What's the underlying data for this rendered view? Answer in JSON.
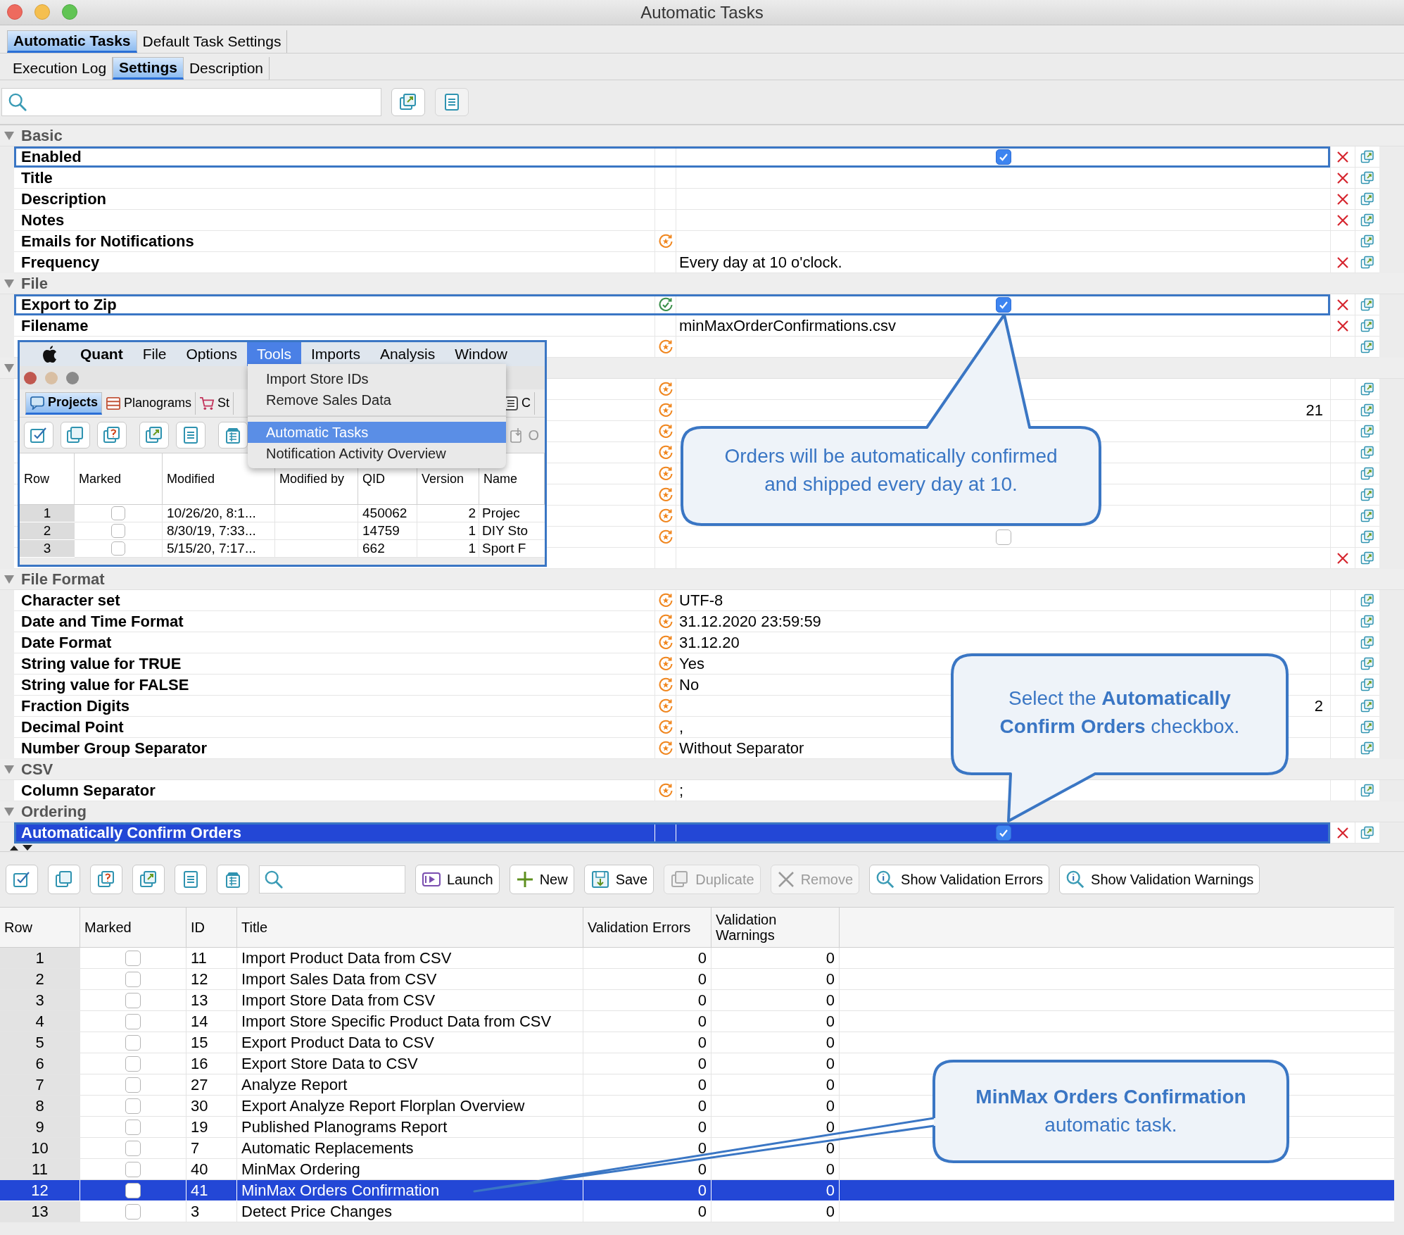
{
  "window": {
    "title": "Automatic Tasks"
  },
  "tabs": [
    {
      "label": "Automatic Tasks",
      "selected": true
    },
    {
      "label": "Default Task Settings",
      "selected": false
    }
  ],
  "subtabs": [
    {
      "label": "Execution Log",
      "selected": false
    },
    {
      "label": "Settings",
      "selected": true
    },
    {
      "label": "Description",
      "selected": false
    }
  ],
  "properties": [
    {
      "kind": "group",
      "label": "Basic",
      "expanded": true
    },
    {
      "kind": "checkbox",
      "label": "Enabled",
      "checked": true,
      "inherited": false,
      "linked": false,
      "reset": true,
      "highlighted": true,
      "selected": false
    },
    {
      "kind": "empty",
      "label": "Title",
      "inherited": false,
      "linked": false,
      "reset": true,
      "highlighted": false,
      "selected": false
    },
    {
      "kind": "empty",
      "label": "Description",
      "inherited": false,
      "linked": false,
      "reset": true,
      "highlighted": false,
      "selected": false
    },
    {
      "kind": "empty",
      "label": "Notes",
      "inherited": false,
      "linked": false,
      "reset": true,
      "highlighted": false,
      "selected": false
    },
    {
      "kind": "empty",
      "label": "Emails for Notifications",
      "inherited": true,
      "linked": false,
      "reset": false,
      "highlighted": false,
      "selected": false
    },
    {
      "kind": "text",
      "label": "Frequency",
      "value": "Every day at 10 o'clock.",
      "inherited": false,
      "linked": false,
      "reset": true,
      "highlighted": false,
      "selected": false
    },
    {
      "kind": "group",
      "label": "File",
      "expanded": true
    },
    {
      "kind": "checkbox",
      "label": "Export to Zip",
      "checked": true,
      "inherited": false,
      "linked": true,
      "reset": true,
      "highlighted": true,
      "selected": false
    },
    {
      "kind": "text",
      "label": "Filename",
      "value": "minMaxOrderConfirmations.csv",
      "inherited": false,
      "linked": false,
      "reset": true,
      "highlighted": false,
      "selected": false
    },
    {
      "kind": "empty",
      "inherited": true,
      "linked": false,
      "reset": false,
      "highlighted": false,
      "selected": false
    },
    {
      "kind": "group",
      "expanded": true
    },
    {
      "kind": "empty",
      "inherited": true,
      "linked": false,
      "reset": false,
      "highlighted": false,
      "selected": false
    },
    {
      "kind": "number",
      "value": "21",
      "inherited": true,
      "linked": false,
      "reset": false,
      "highlighted": false,
      "selected": false
    },
    {
      "kind": "empty",
      "inherited": true,
      "linked": false,
      "reset": false,
      "highlighted": false,
      "selected": false
    },
    {
      "kind": "empty",
      "inherited": true,
      "linked": false,
      "reset": false,
      "highlighted": false,
      "selected": false
    },
    {
      "kind": "empty",
      "inherited": true,
      "linked": false,
      "reset": false,
      "highlighted": false,
      "selected": false
    },
    {
      "kind": "empty",
      "inherited": true,
      "linked": false,
      "reset": false,
      "highlighted": false,
      "selected": false
    },
    {
      "kind": "empty",
      "inherited": true,
      "linked": false,
      "reset": false,
      "highlighted": false,
      "selected": false
    },
    {
      "kind": "checkbox",
      "checked": false,
      "inherited": true,
      "linked": false,
      "reset": false,
      "highlighted": false,
      "selected": false
    },
    {
      "kind": "empty",
      "inherited": false,
      "linked": false,
      "reset": true,
      "highlighted": false,
      "selected": false
    },
    {
      "kind": "group",
      "label": "File Format",
      "expanded": true
    },
    {
      "kind": "text",
      "label": "Character set",
      "value": "UTF-8",
      "inherited": true,
      "linked": false,
      "reset": false,
      "highlighted": false,
      "selected": false
    },
    {
      "kind": "text",
      "label": "Date and Time Format",
      "value": "31.12.2020 23:59:59",
      "inherited": true,
      "linked": false,
      "reset": false,
      "highlighted": false,
      "selected": false
    },
    {
      "kind": "text",
      "label": "Date Format",
      "value": "31.12.20",
      "inherited": true,
      "linked": false,
      "reset": false,
      "highlighted": false,
      "selected": false
    },
    {
      "kind": "text",
      "label": "String value for TRUE",
      "value": "Yes",
      "inherited": true,
      "linked": false,
      "reset": false,
      "highlighted": false,
      "selected": false
    },
    {
      "kind": "text",
      "label": "String value for FALSE",
      "value": "No",
      "inherited": true,
      "linked": false,
      "reset": false,
      "highlighted": false,
      "selected": false
    },
    {
      "kind": "number",
      "label": "Fraction Digits",
      "value": "2",
      "inherited": true,
      "linked": false,
      "reset": false,
      "highlighted": false,
      "selected": false
    },
    {
      "kind": "text",
      "label": "Decimal Point",
      "value": ",",
      "inherited": true,
      "linked": false,
      "reset": false,
      "highlighted": false,
      "selected": false
    },
    {
      "kind": "text",
      "label": "Number Group Separator",
      "value": "Without Separator",
      "inherited": true,
      "linked": false,
      "reset": false,
      "highlighted": false,
      "selected": false
    },
    {
      "kind": "group",
      "label": "CSV",
      "expanded": true
    },
    {
      "kind": "text",
      "label": "Column Separator",
      "value": ";",
      "inherited": true,
      "linked": false,
      "reset": false,
      "highlighted": false,
      "selected": false
    },
    {
      "kind": "group",
      "label": "Ordering",
      "expanded": true
    },
    {
      "kind": "checkbox",
      "label": "Automatically Confirm Orders",
      "checked": true,
      "inherited": false,
      "linked": false,
      "reset": true,
      "highlighted": true,
      "selected": true
    }
  ],
  "toolbar": {
    "buttons": [
      {
        "label": "Launch",
        "disabled": false
      },
      {
        "label": "New",
        "disabled": false
      },
      {
        "label": "Save",
        "disabled": false
      },
      {
        "label": "Duplicate",
        "disabled": true
      },
      {
        "label": "Remove",
        "disabled": true
      },
      {
        "label": "Show Validation Errors",
        "disabled": false
      },
      {
        "label": "Show Validation Warnings",
        "disabled": false
      }
    ]
  },
  "table": {
    "columns": [
      "Row",
      "Marked",
      "ID",
      "Title",
      "Validation Errors",
      "Validation Warnings"
    ],
    "rows": [
      {
        "row": "1",
        "marked": false,
        "id": "11",
        "title": "Import Product Data from CSV",
        "errors": "0",
        "warnings": "0",
        "selected": false
      },
      {
        "row": "2",
        "marked": false,
        "id": "12",
        "title": "Import Sales Data from CSV",
        "errors": "0",
        "warnings": "0",
        "selected": false
      },
      {
        "row": "3",
        "marked": false,
        "id": "13",
        "title": "Import Store Data from CSV",
        "errors": "0",
        "warnings": "0",
        "selected": false
      },
      {
        "row": "4",
        "marked": false,
        "id": "14",
        "title": "Import Store Specific Product Data from CSV",
        "errors": "0",
        "warnings": "0",
        "selected": false
      },
      {
        "row": "5",
        "marked": false,
        "id": "15",
        "title": "Export Product Data to CSV",
        "errors": "0",
        "warnings": "0",
        "selected": false
      },
      {
        "row": "6",
        "marked": false,
        "id": "16",
        "title": "Export Store Data to CSV",
        "errors": "0",
        "warnings": "0",
        "selected": false
      },
      {
        "row": "7",
        "marked": false,
        "id": "27",
        "title": "Analyze Report",
        "errors": "0",
        "warnings": "0",
        "selected": false
      },
      {
        "row": "8",
        "marked": false,
        "id": "30",
        "title": "Export Analyze Report Florplan Overview",
        "errors": "0",
        "warnings": "0",
        "selected": false
      },
      {
        "row": "9",
        "marked": false,
        "id": "19",
        "title": "Published Planograms Report",
        "errors": "0",
        "warnings": "0",
        "selected": false
      },
      {
        "row": "10",
        "marked": false,
        "id": "7",
        "title": "Automatic Replacements",
        "errors": "0",
        "warnings": "0",
        "selected": false
      },
      {
        "row": "11",
        "marked": false,
        "id": "40",
        "title": "MinMax Ordering",
        "errors": "0",
        "warnings": "0",
        "selected": false
      },
      {
        "row": "12",
        "marked": false,
        "id": "41",
        "title": "MinMax Orders Confirmation",
        "errors": "0",
        "warnings": "0",
        "selected": true
      },
      {
        "row": "13",
        "marked": false,
        "id": "3",
        "title": "Detect Price Changes",
        "errors": "0",
        "warnings": "0",
        "selected": false
      }
    ]
  },
  "inset": {
    "menu_bar": [
      {
        "label": "Quant",
        "kind": "app",
        "selected": false
      },
      {
        "label": "File",
        "kind": "menu",
        "selected": false
      },
      {
        "label": "Options",
        "kind": "menu",
        "selected": false
      },
      {
        "label": "Tools",
        "kind": "menu",
        "selected": true
      },
      {
        "label": "Imports",
        "kind": "menu",
        "selected": false
      },
      {
        "label": "Analysis",
        "kind": "menu",
        "selected": false
      },
      {
        "label": "Window",
        "kind": "menu",
        "selected": false
      }
    ],
    "menu_sections": [
      {
        "items": [
          {
            "label": "Import Store IDs",
            "selected": false
          },
          {
            "label": "Remove Sales Data",
            "selected": false
          }
        ]
      },
      {
        "items": [
          {
            "label": "Automatic Tasks",
            "selected": true
          },
          {
            "label": "Notification Activity Overview",
            "selected": false
          }
        ]
      }
    ],
    "tabs": [
      {
        "label": "Projects",
        "selected": true
      },
      {
        "label": "Planograms",
        "selected": false
      },
      {
        "label": "St",
        "selected": false
      },
      {
        "label": "C",
        "selected": false
      }
    ],
    "toolbar_button": {
      "label": "O",
      "disabled": true
    },
    "table": {
      "columns": [
        "Row",
        "Marked",
        "Modified",
        "Modified by",
        "QID",
        "Version",
        "Name"
      ],
      "rows": [
        {
          "row": "1",
          "marked": false,
          "modified": "10/26/20, 8:1...",
          "qid": "450062",
          "version": "2",
          "name": "Projec"
        },
        {
          "row": "2",
          "marked": false,
          "modified": "8/30/19, 7:33...",
          "qid": "14759",
          "version": "1",
          "name": "DIY Sto"
        },
        {
          "row": "3",
          "marked": false,
          "modified": "5/15/20, 7:17...",
          "qid": "662",
          "version": "1",
          "name": "Sport F"
        }
      ]
    }
  },
  "callouts": [
    {
      "text": "Orders will be automatically confirmed and shipped every day at 10."
    },
    {
      "text": "Select the **Automatically Confirm Orders** checkbox."
    },
    {
      "text": "**MinMax Orders Confirmation** automatic task."
    }
  ]
}
